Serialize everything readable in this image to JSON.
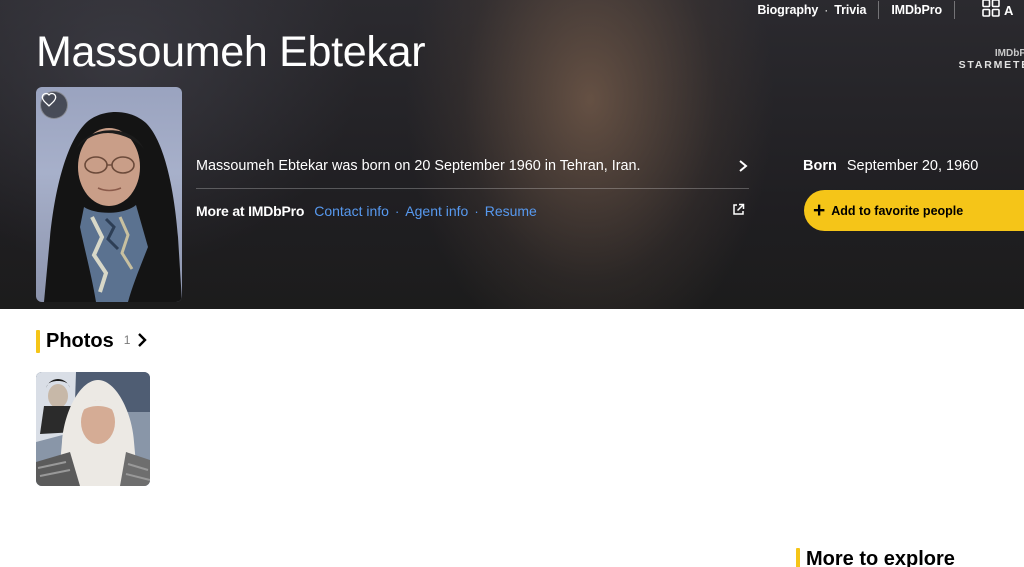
{
  "header": {
    "links": [
      "Biography",
      "Trivia"
    ],
    "imdbpro": "IMDbPro",
    "all_topics_cut": "A",
    "starmeter_top": "IMDbP",
    "starmeter_bottom": "STARMETE"
  },
  "person": {
    "name": "Massoumeh Ebtekar",
    "bio": "Massoumeh Ebtekar was born on 20 September 1960 in Tehran, Iran.",
    "born_label": "Born",
    "born_value": "September 20, 1960"
  },
  "more_at": {
    "label": "More at IMDbPro",
    "links": [
      "Contact info",
      "Agent info",
      "Resume"
    ]
  },
  "favorite_button": "Add to favorite people",
  "photos": {
    "title": "Photos",
    "count": "1"
  },
  "explore": {
    "title": "More to explore"
  },
  "colors": {
    "accent": "#f5c518",
    "link": "#5799ef",
    "hero_bg": "#1f1e21"
  },
  "icons": [
    "heart-outline-icon",
    "chevron-right-icon",
    "external-link-icon",
    "plus-icon",
    "grid-icon"
  ]
}
